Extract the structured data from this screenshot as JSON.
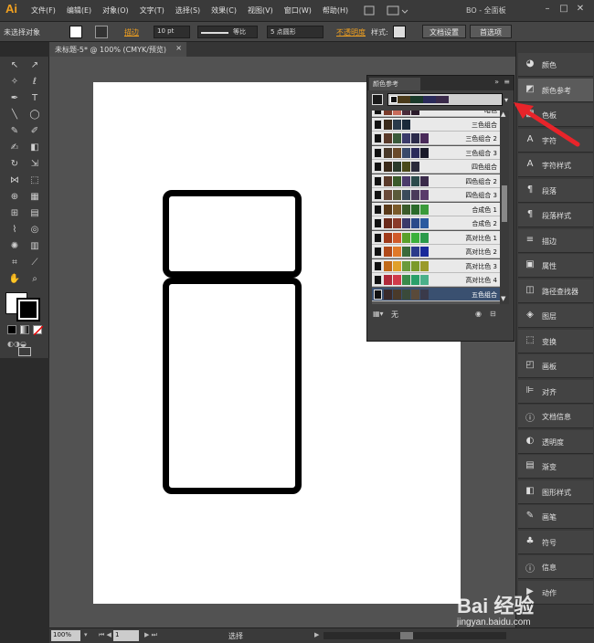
{
  "menubar": {
    "logo": "Ai",
    "menus": [
      "文件(F)",
      "编辑(E)",
      "对象(O)",
      "文字(T)",
      "选择(S)",
      "效果(C)",
      "视图(V)",
      "窗口(W)",
      "帮助(H)"
    ],
    "workspace": "BO - 全面板",
    "window_controls": [
      "–",
      "□",
      "✕"
    ]
  },
  "controlbar": {
    "selection_status": "未选择对象",
    "stroke_label": "描边",
    "stroke_weight": "10 pt",
    "stroke_profile": "等比",
    "brush": "5 点圆形",
    "opacity_label": "不透明度",
    "style_label": "样式:",
    "doc_setup_button": "文档设置",
    "preferences_button": "首选项"
  },
  "document": {
    "tab_title": "未标题-5* @ 100% (CMYK/预览)",
    "tab_close": "×"
  },
  "statusbar": {
    "zoom": "100%",
    "artboard_number": "1",
    "tool_name": "选择"
  },
  "color_guide": {
    "tab_label": "颜色参考",
    "bottom_label": "无",
    "rows": [
      {
        "label": "暗色",
        "swatches": [
          "#7a3a2a",
          "#c86a5a",
          "#4a2a3a",
          "#2a1a2a"
        ]
      },
      {
        "label": "三色组合",
        "swatches": [
          "#3a2a1a",
          "#2a3a4a",
          "#1a2a3a"
        ]
      },
      {
        "label": "三色组合 2",
        "swatches": [
          "#5a3a2a",
          "#3a5a3a",
          "#3a3a6a",
          "#2a2a4a",
          "#4a2a5a"
        ]
      },
      {
        "label": "三色组合 3",
        "swatches": [
          "#4a3a2a",
          "#6a4a2a",
          "#3a4a6a",
          "#2a2a5a",
          "#1a1a2a"
        ]
      },
      {
        "label": "四色组合",
        "swatches": [
          "#3a2a1a",
          "#2a3a2a",
          "#4a4a1a",
          "#2a2a3a"
        ]
      },
      {
        "label": "四色组合 2",
        "swatches": [
          "#5a3a2a",
          "#3a5a2a",
          "#4a3a6a",
          "#2a4a4a",
          "#3a2a4a"
        ]
      },
      {
        "label": "四色组合 3",
        "swatches": [
          "#6a4a3a",
          "#5a5a3a",
          "#3a4a5a",
          "#4a3a5a",
          "#5a3a6a"
        ]
      },
      {
        "label": "合成色 1",
        "swatches": [
          "#5a3a1a",
          "#7a5a2a",
          "#3a5a2a",
          "#2a6a2a",
          "#3a9a3a"
        ]
      },
      {
        "label": "合成色 2",
        "swatches": [
          "#6a2a1a",
          "#8a3a2a",
          "#3a3a6a",
          "#2a4a8a",
          "#2a5aa0"
        ]
      },
      {
        "label": "高对比色 1",
        "swatches": [
          "#a03a1a",
          "#d05a2a",
          "#5aa02a",
          "#3ab03a",
          "#2a9a4a"
        ]
      },
      {
        "label": "高对比色 2",
        "swatches": [
          "#b04a1a",
          "#e07a2a",
          "#3a6a3a",
          "#2a3a8a",
          "#1a2a9a"
        ]
      },
      {
        "label": "高对比色 3",
        "swatches": [
          "#c06a1a",
          "#e0a02a",
          "#6a9a3a",
          "#7a9a2a",
          "#9a9a2a"
        ]
      },
      {
        "label": "高对比色 4",
        "swatches": [
          "#b02a3a",
          "#d03a4a",
          "#3a8a4a",
          "#2aa06a",
          "#4ab08a"
        ]
      },
      {
        "label": "五色组合",
        "swatches": [
          "#3a2a2a",
          "#4a3a2a",
          "#3a4a3a",
          "#5a4a3a",
          "#3a3a4a"
        ]
      }
    ]
  },
  "dock": [
    {
      "icon": "color-icon",
      "label": "颜色"
    },
    {
      "icon": "color-guide-icon",
      "label": "颜色参考"
    },
    {
      "icon": "swatches-icon",
      "label": "色板"
    },
    {
      "icon": "character-icon",
      "label": "字符"
    },
    {
      "icon": "character-style-icon",
      "label": "字符样式"
    },
    {
      "icon": "paragraph-icon",
      "label": "段落"
    },
    {
      "icon": "paragraph-style-icon",
      "label": "段落样式"
    },
    {
      "icon": "stroke-icon",
      "label": "描边"
    },
    {
      "icon": "attributes-icon",
      "label": "属性"
    },
    {
      "icon": "pathfinder-icon",
      "label": "路径查找器"
    },
    {
      "icon": "layers-icon",
      "label": "图层"
    },
    {
      "icon": "transform-icon",
      "label": "变换"
    },
    {
      "icon": "artboards-icon",
      "label": "画板"
    },
    {
      "icon": "align-icon",
      "label": "对齐"
    },
    {
      "icon": "document-info-icon",
      "label": "文档信息"
    },
    {
      "icon": "transparency-icon",
      "label": "透明度"
    },
    {
      "icon": "gradient-icon",
      "label": "渐变"
    },
    {
      "icon": "graphic-styles-icon",
      "label": "图形样式"
    },
    {
      "icon": "brushes-icon",
      "label": "画笔"
    },
    {
      "icon": "symbols-icon",
      "label": "符号"
    },
    {
      "icon": "info-icon",
      "label": "信息"
    },
    {
      "icon": "actions-icon",
      "label": "动作"
    }
  ],
  "colors": {
    "accent_orange": "#f0a020",
    "arrow_red": "#e8242a"
  },
  "watermark": {
    "brand": "Bai 经验",
    "url": "jingyan.baidu.com"
  }
}
